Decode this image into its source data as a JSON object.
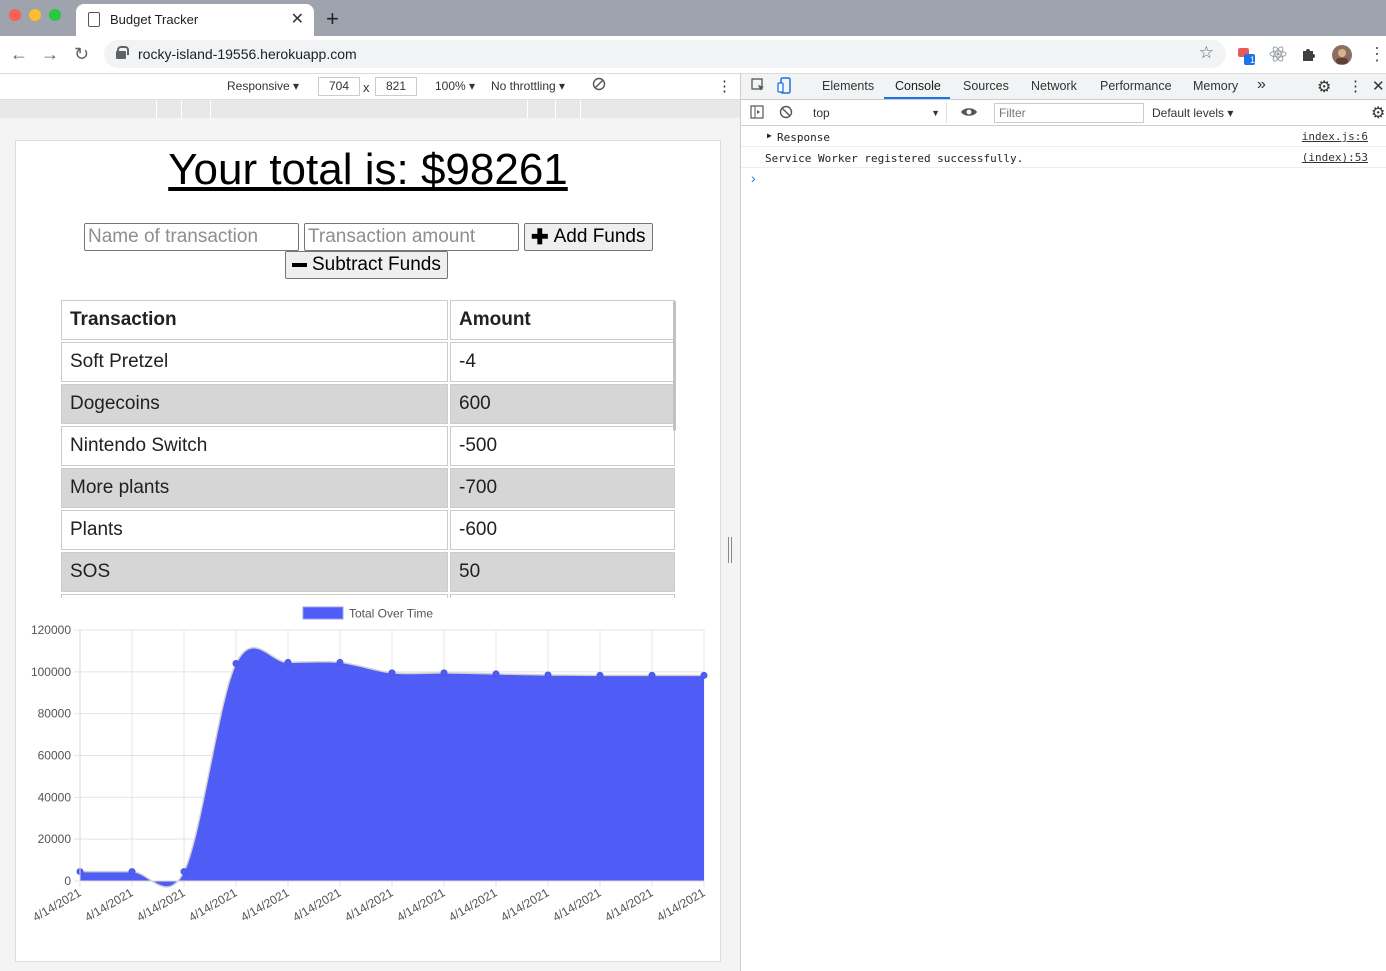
{
  "browser": {
    "tab_title": "Budget Tracker",
    "url": "rocky-island-19556.herokuapp.com",
    "extension_badge": "1"
  },
  "device_toolbar": {
    "mode": "Responsive ▾",
    "width": "704",
    "height": "821",
    "times": "x",
    "zoom": "100% ▾",
    "throttling": "No throttling ▾"
  },
  "app": {
    "total_label": "Your total is: $98261",
    "name_placeholder": "Name of transaction",
    "amount_placeholder": "Transaction amount",
    "add_label": "Add Funds",
    "subtract_label": "Subtract Funds",
    "table": {
      "headers": [
        "Transaction",
        "Amount"
      ],
      "rows": [
        {
          "name": "Soft Pretzel",
          "amount": "-4"
        },
        {
          "name": "Dogecoins",
          "amount": "600"
        },
        {
          "name": "Nintendo Switch",
          "amount": "-500"
        },
        {
          "name": "More plants",
          "amount": "-700"
        },
        {
          "name": "Plants",
          "amount": "-600"
        },
        {
          "name": "SOS",
          "amount": "50"
        },
        {
          "name": "",
          "amount": ""
        }
      ]
    }
  },
  "chart_data": {
    "type": "area",
    "series": [
      {
        "name": "Total Over Time",
        "color": "#4f5cf6",
        "values": [
          4500,
          4500,
          4500,
          104000,
          104500,
          104500,
          99500,
          99500,
          99000,
          98500,
          98300,
          98300,
          98300
        ]
      }
    ],
    "categories": [
      "4/14/2021",
      "4/14/2021",
      "4/14/2021",
      "4/14/2021",
      "4/14/2021",
      "4/14/2021",
      "4/14/2021",
      "4/14/2021",
      "4/14/2021",
      "4/14/2021",
      "4/14/2021",
      "4/14/2021",
      "4/14/2021"
    ],
    "y_ticks": [
      "120000",
      "100000",
      "80000",
      "60000",
      "40000",
      "20000",
      "0"
    ],
    "ylim": [
      0,
      120000
    ],
    "grid": true,
    "legend": "top"
  },
  "devtools": {
    "tabs": [
      "Elements",
      "Console",
      "Sources",
      "Network",
      "Performance",
      "Memory"
    ],
    "more": "»",
    "context": "top",
    "filter_placeholder": "Filter",
    "levels": "Default levels ▾",
    "logs": [
      {
        "message": "Response",
        "source": "index.js:6"
      },
      {
        "message": "Service Worker registered successfully.",
        "source": "(index):53"
      }
    ],
    "prompt": "›"
  }
}
